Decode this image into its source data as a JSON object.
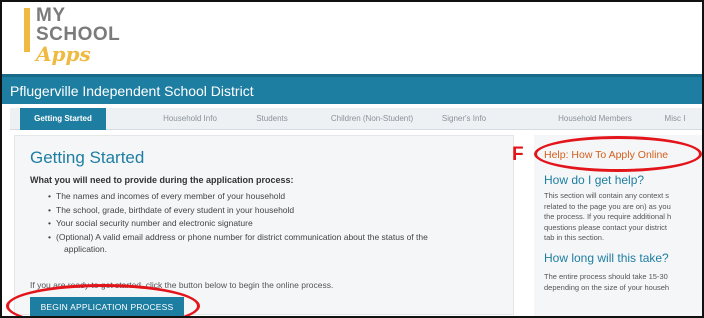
{
  "logo": {
    "line1": "MY",
    "line2": "SCHOOL",
    "line3": "Apps"
  },
  "district": {
    "title": "Pflugerville Independent School District"
  },
  "tabs": [
    {
      "label": "Getting Started",
      "active": true
    },
    {
      "label": "Household Info",
      "active": false
    },
    {
      "label": "Students",
      "active": false
    },
    {
      "label": "Children (Non-Student)",
      "active": false
    },
    {
      "label": "Signer's Info",
      "active": false
    },
    {
      "label": "Household Members",
      "active": false
    },
    {
      "label": "Misc I",
      "active": false
    }
  ],
  "main": {
    "title": "Getting Started",
    "intro": "What you will need to provide during the application process:",
    "requirements": [
      "The names and incomes of every member of your household",
      "The school, grade, birthdate of every student in your household",
      "Your social security number and electronic signature",
      "(Optional) A valid email address or phone number for district communication about the status of the",
      "application."
    ],
    "ready_text": "If you are ready to get started, click the button below to begin the online process.",
    "begin_button": "BEGIN APPLICATION PROCESS"
  },
  "side": {
    "help_title": "Help: How To Apply Online",
    "help_heading": "How do I get help?",
    "help_lines": [
      "This section will contain any context s",
      "related to the page you are on) as you",
      "the process. If you require additional h",
      "questions please contact your district",
      "tab in this section."
    ],
    "time_heading": "How long will this take?",
    "time_lines": [
      "The entire process should take 15-30",
      "depending on the size of your househ"
    ]
  },
  "annotation": {
    "marker": "F",
    "color": "#e3141a"
  },
  "colors": {
    "brand_blue": "#1e7ea1",
    "logo_gold": "#f0b940",
    "help_orange": "#d45f1c"
  }
}
